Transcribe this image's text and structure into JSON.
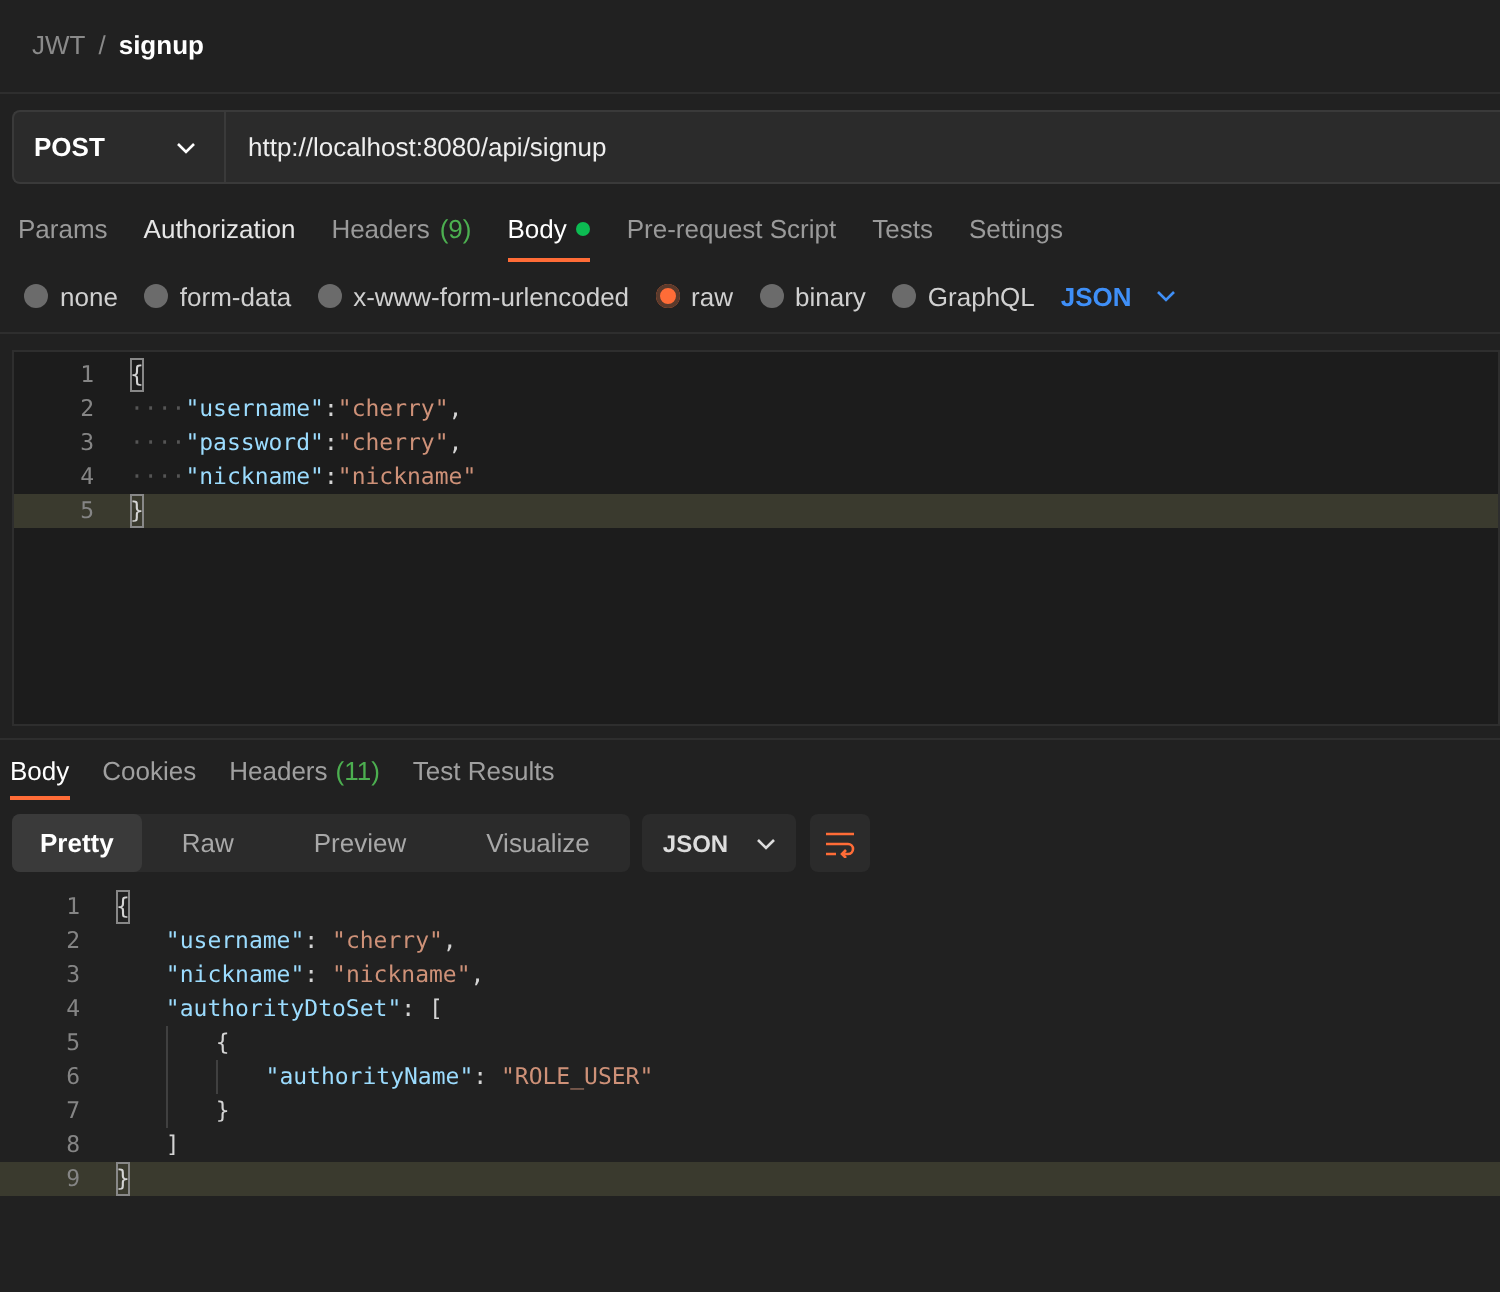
{
  "breadcrumb": {
    "parent": "JWT",
    "separator": "/",
    "current": "signup"
  },
  "request": {
    "method": "POST",
    "url": "http://localhost:8080/api/signup"
  },
  "request_tabs": [
    {
      "label": "Params",
      "selected": false,
      "emphasized": false
    },
    {
      "label": "Authorization",
      "selected": false,
      "emphasized": true
    },
    {
      "label": "Headers",
      "count": "(9)",
      "selected": false,
      "emphasized": false
    },
    {
      "label": "Body",
      "selected": true,
      "emphasized": true,
      "dot": true
    },
    {
      "label": "Pre-request Script",
      "selected": false,
      "emphasized": false
    },
    {
      "label": "Tests",
      "selected": false,
      "emphasized": false
    },
    {
      "label": "Settings",
      "selected": false,
      "emphasized": false
    }
  ],
  "body_types": [
    {
      "label": "none",
      "selected": false
    },
    {
      "label": "form-data",
      "selected": false
    },
    {
      "label": "x-www-form-urlencoded",
      "selected": false
    },
    {
      "label": "raw",
      "selected": true
    },
    {
      "label": "binary",
      "selected": false
    },
    {
      "label": "GraphQL",
      "selected": false
    }
  ],
  "body_format": "JSON",
  "request_editor": [
    {
      "number": "1",
      "current": false,
      "tokens": [
        {
          "kind": "brace",
          "text": "{",
          "matched": true
        }
      ]
    },
    {
      "number": "2",
      "current": false,
      "tokens": [
        {
          "kind": "ws",
          "text": "····"
        },
        {
          "kind": "key",
          "text": "\"username\""
        },
        {
          "kind": "punct",
          "text": ":"
        },
        {
          "kind": "string",
          "text": "\"cherry\""
        },
        {
          "kind": "punct",
          "text": ","
        }
      ]
    },
    {
      "number": "3",
      "current": false,
      "tokens": [
        {
          "kind": "ws",
          "text": "····"
        },
        {
          "kind": "key",
          "text": "\"password\""
        },
        {
          "kind": "punct",
          "text": ":"
        },
        {
          "kind": "string",
          "text": "\"cherry\""
        },
        {
          "kind": "punct",
          "text": ","
        }
      ]
    },
    {
      "number": "4",
      "current": false,
      "tokens": [
        {
          "kind": "ws",
          "text": "····"
        },
        {
          "kind": "key",
          "text": "\"nickname\""
        },
        {
          "kind": "punct",
          "text": ":"
        },
        {
          "kind": "string",
          "text": "\"nickname\""
        }
      ]
    },
    {
      "number": "5",
      "current": true,
      "tokens": [
        {
          "kind": "brace",
          "text": "}",
          "matched": true
        }
      ]
    }
  ],
  "response_tabs": [
    {
      "label": "Body",
      "selected": true
    },
    {
      "label": "Cookies",
      "selected": false
    },
    {
      "label": "Headers",
      "count": "(11)",
      "selected": false
    },
    {
      "label": "Test Results",
      "selected": false
    }
  ],
  "view_modes": [
    {
      "label": "Pretty",
      "selected": true
    },
    {
      "label": "Raw",
      "selected": false
    },
    {
      "label": "Preview",
      "selected": false
    },
    {
      "label": "Visualize",
      "selected": false
    }
  ],
  "response_format": "JSON",
  "response_editor": [
    {
      "number": "1",
      "current": false,
      "tokens": [
        {
          "kind": "brace",
          "text": "{",
          "matched": true
        }
      ],
      "children": [
        {
          "number": "2",
          "current": false,
          "tokens": [
            {
              "kind": "key",
              "text": "\"username\""
            },
            {
              "kind": "punct",
              "text": ": "
            },
            {
              "kind": "string",
              "text": "\"cherry\""
            },
            {
              "kind": "punct",
              "text": ","
            }
          ]
        },
        {
          "number": "3",
          "current": false,
          "tokens": [
            {
              "kind": "key",
              "text": "\"nickname\""
            },
            {
              "kind": "punct",
              "text": ": "
            },
            {
              "kind": "string",
              "text": "\"nickname\""
            },
            {
              "kind": "punct",
              "text": ","
            }
          ]
        },
        {
          "number": "4",
          "current": false,
          "tokens": [
            {
              "kind": "key",
              "text": "\"authorityDtoSet\""
            },
            {
              "kind": "punct",
              "text": ": ["
            }
          ],
          "children": [
            {
              "number": "5",
              "current": false,
              "tokens": [
                {
                  "kind": "brace",
                  "text": "{",
                  "matched": false
                }
              ],
              "children": [
                {
                  "number": "6",
                  "current": false,
                  "tokens": [
                    {
                      "kind": "key",
                      "text": "\"authorityName\""
                    },
                    {
                      "kind": "punct",
                      "text": ": "
                    },
                    {
                      "kind": "string",
                      "text": "\"ROLE_USER\""
                    }
                  ]
                }
              ]
            },
            {
              "number": "7",
              "current": false,
              "tokens": [
                {
                  "kind": "brace",
                  "text": "}",
                  "matched": false
                }
              ]
            }
          ]
        },
        {
          "number": "8",
          "current": false,
          "tokens": [
            {
              "kind": "punct",
              "text": "]"
            }
          ]
        }
      ]
    },
    {
      "number": "9",
      "current": true,
      "tokens": [
        {
          "kind": "brace",
          "text": "}",
          "matched": true
        }
      ]
    }
  ]
}
